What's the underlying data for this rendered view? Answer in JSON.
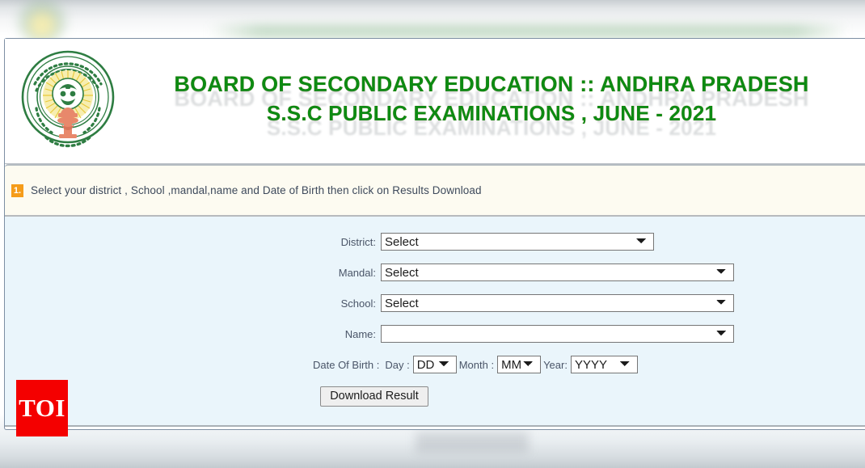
{
  "header": {
    "emblem_alt": "Government of Andhra Pradesh emblem",
    "title_line1": "BOARD OF SECONDARY EDUCATION :: ANDHRA PRADESH",
    "title_line2": "S.S.C PUBLIC EXAMINATIONS , JUNE - 2021",
    "title_color": "#0d8a12"
  },
  "instruction": {
    "number": "1.",
    "badge_color": "#f59c1a",
    "text": "Select your district , School ,mandal,name  and Date of Birth then click on Results Download"
  },
  "form": {
    "fields": [
      {
        "label": "District:",
        "value": "Select",
        "options": [
          "Select"
        ]
      },
      {
        "label": "Mandal:",
        "value": "Select",
        "options": [
          "Select"
        ]
      },
      {
        "label": "School:",
        "value": "Select",
        "options": [
          "Select"
        ]
      },
      {
        "label": "Name:",
        "value": "",
        "options": [
          ""
        ]
      }
    ],
    "dob": {
      "label": "Date Of Birth :",
      "day_label": "Day :",
      "day_value": "DD",
      "month_label": "Month :",
      "month_value": "MM",
      "year_label": "Year:",
      "year_value": "YYYY"
    },
    "submit_label": "Download Result"
  },
  "watermark": {
    "text": "TOI",
    "color": "#f40000"
  }
}
